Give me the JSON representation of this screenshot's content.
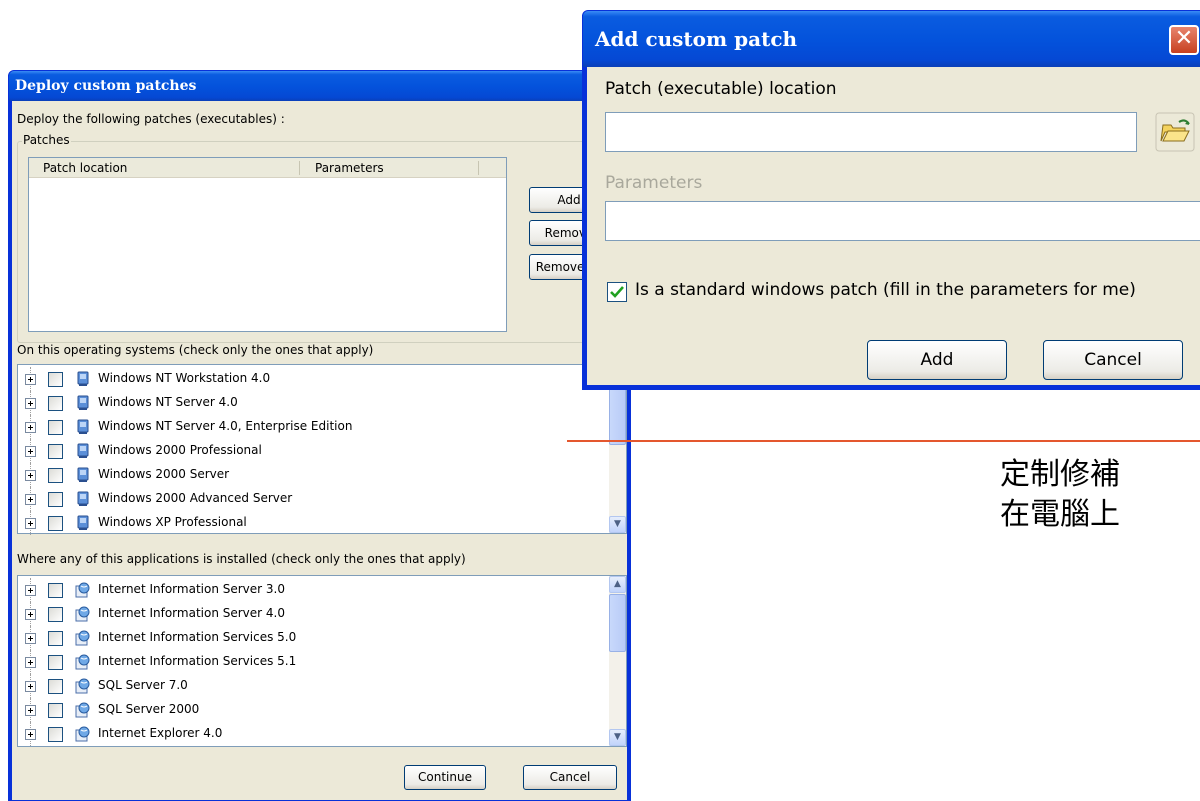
{
  "main_window": {
    "title": "Deploy custom patches",
    "intro_label": "Deploy the following patches (executables) :",
    "patches_group_label": "Patches",
    "columns": [
      "Patch location",
      "Parameters"
    ],
    "buttons": {
      "add": "Add",
      "remove": "Remove",
      "remove_all": "Remove all",
      "continue": "Continue",
      "cancel": "Cancel"
    },
    "os_label": "On this operating systems (check only the ones that apply)",
    "os_items": [
      "Windows NT Workstation 4.0",
      "Windows NT Server 4.0",
      "Windows NT Server 4.0, Enterprise Edition",
      "Windows 2000 Professional",
      "Windows 2000 Server",
      "Windows 2000 Advanced Server",
      "Windows XP Professional"
    ],
    "apps_label": "Where any of this applications is installed (check only the ones that apply)",
    "app_items": [
      "Internet Information Server 3.0",
      "Internet Information Server 4.0",
      "Internet Information Services 5.0",
      "Internet Information Services 5.1",
      "SQL Server 7.0",
      "SQL Server 2000",
      "Internet Explorer 4.0"
    ]
  },
  "dialog": {
    "title": "Add custom patch",
    "location_label": "Patch (executable)  location",
    "location_value": "",
    "parameters_label": "Parameters",
    "parameters_value": "",
    "standard_patch_label": "Is a standard windows patch (fill in the parameters for me)",
    "standard_patch_checked": true,
    "add_button": "Add",
    "cancel_button": "Cancel"
  },
  "annotation": {
    "line1": "定制修補",
    "line2": "在電腦上"
  },
  "colors": {
    "titlebar": "#0453dc",
    "window_frame": "#0831d9",
    "dialog_bg": "#ece9d8",
    "annotation_line": "#e4572e"
  }
}
